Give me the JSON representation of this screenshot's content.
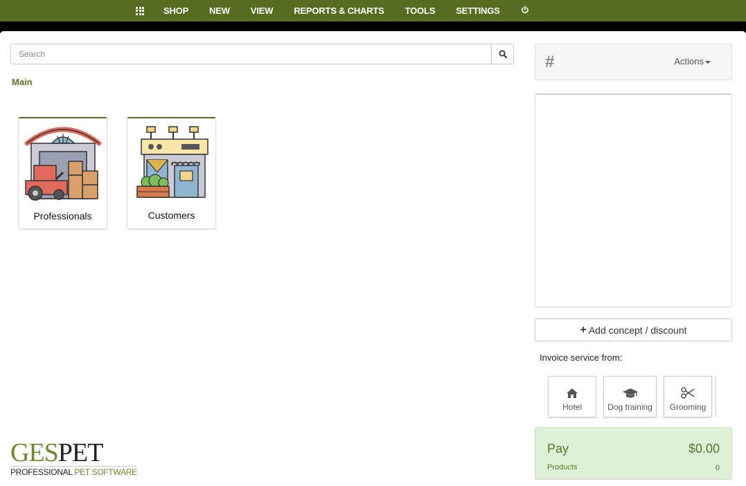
{
  "nav": {
    "items": [
      "SHOP",
      "NEW",
      "VIEW",
      "REPORTS & CHARTS",
      "TOOLS",
      "SETTINGS"
    ]
  },
  "search": {
    "placeholder": "Search"
  },
  "breadcrumb": "Main",
  "tiles": [
    {
      "label": "Professionals",
      "icon": "warehouse-icon"
    },
    {
      "label": "Customers",
      "icon": "storefront-icon"
    }
  ],
  "logo": {
    "brand_left": "GES",
    "brand_right": "PET",
    "tag_left": "PROFESSIONAL ",
    "tag_right": "PET SOFTWARE"
  },
  "ticket": {
    "number_symbol": "#",
    "actions_label": "Actions"
  },
  "add_concept_label": "Add concept / discount",
  "invoice_from_label": "Invoice service from:",
  "services": [
    {
      "label": "Hotel",
      "icon": "home-icon"
    },
    {
      "label": "Dog training",
      "icon": "graduation-cap-icon"
    },
    {
      "label": "Grooming",
      "icon": "scissors-icon"
    }
  ],
  "pay": {
    "label": "Pay",
    "amount": "$0.00",
    "products_label": "Products",
    "products_count": "0"
  },
  "colors": {
    "nav_bg": "#576c1f",
    "accent_green": "#5b7425",
    "pay_bg": "#dff0d8"
  }
}
